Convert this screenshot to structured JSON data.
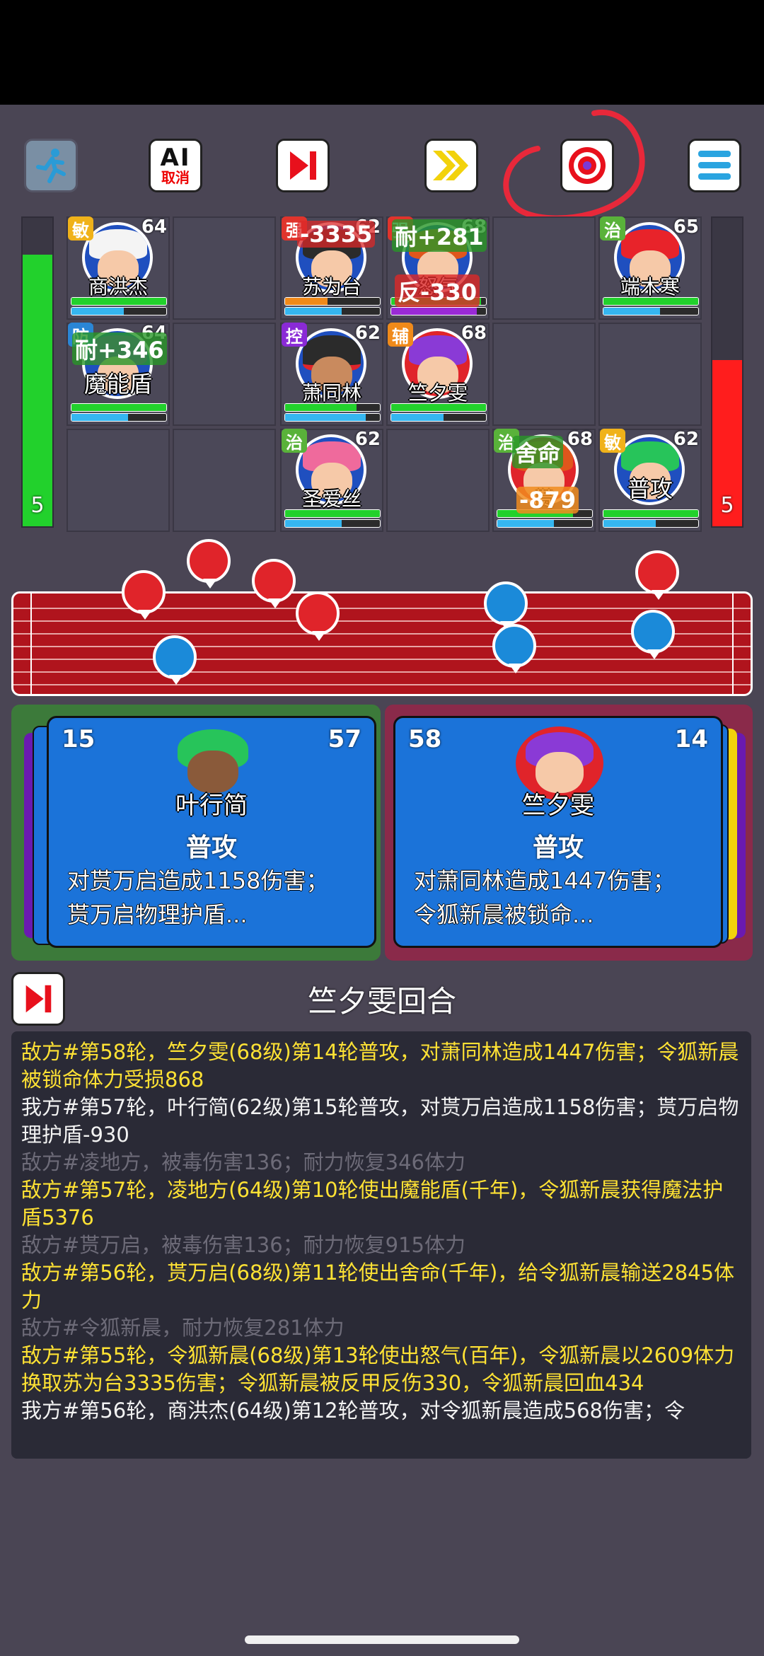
{
  "toolbar": {
    "ai_label": "AI",
    "ai_sub_label": "取消"
  },
  "team_hp": {
    "left_count": "5",
    "right_count": "5",
    "left_fill_fraction": 0.88,
    "right_fill_fraction": 0.54
  },
  "units": [
    {
      "tag": "敏",
      "level": "64",
      "name": "商洪杰",
      "hp": 1.0,
      "mp": 0.55
    },
    {
      "tag": "强",
      "level": "62",
      "name": "苏为台",
      "hp": 0.45,
      "mp": 0.6
    },
    {
      "tag": "强",
      "level": "68",
      "name": "怒气",
      "hp": 0.95,
      "mp": 0.9
    },
    {
      "tag": "治",
      "level": "65",
      "name": "端木寒",
      "hp": 1.0,
      "mp": 0.6
    },
    {
      "tag": "防",
      "level": "64",
      "name": "魔能盾",
      "hp": 1.0,
      "mp": 0.6
    },
    {
      "tag": "控",
      "level": "62",
      "name": "萧同林",
      "hp": 0.75,
      "mp": 0.85
    },
    {
      "tag": "辅",
      "level": "68",
      "name": "竺夕雯",
      "hp": 1.0,
      "mp": 0.55
    },
    {
      "tag": "治",
      "level": "62",
      "name": "圣爱丝",
      "hp": 1.0,
      "mp": 0.6
    },
    {
      "tag": "治",
      "level": "68",
      "name": "贳",
      "hp": 0.8,
      "mp": 0.6
    },
    {
      "tag": "敏",
      "level": "62",
      "name": "普攻",
      "hp": 1.0,
      "mp": 0.55
    }
  ],
  "floaters": {
    "damage_1": "-3335",
    "heal_1": "耐+281",
    "reflect_1": "反-330",
    "heal_2": "耐+346",
    "skill_1": "舍命",
    "damage_2": "-879"
  },
  "card_left": {
    "num_left": "15",
    "num_right": "57",
    "name": "叶行简",
    "skill": "普攻",
    "desc_line1": "对贳万启造成1158伤害；",
    "desc_line2": "贳万启物理护盾..."
  },
  "card_right": {
    "num_left": "58",
    "num_right": "14",
    "name": "竺夕雯",
    "skill": "普攻",
    "desc_line1": "对萧同林造成1447伤害；",
    "desc_line2": "令狐新晨被锁命..."
  },
  "turn_title": "竺夕雯回合",
  "log": [
    {
      "color": "yellow",
      "text": "敌方#第58轮，竺夕雯(68级)第14轮普攻，对萧同林造成1447伤害；令狐新晨被锁命体力受损868"
    },
    {
      "color": "white",
      "text": "我方#第57轮，叶行简(62级)第15轮普攻，对贳万启造成1158伤害；贳万启物理护盾-930"
    },
    {
      "color": "gray",
      "text": "敌方#凌地方，被毒伤害136；耐力恢复346体力"
    },
    {
      "color": "yellow",
      "text": "敌方#第57轮，凌地方(64级)第10轮使出魔能盾(千年)，令狐新晨获得魔法护盾5376"
    },
    {
      "color": "gray",
      "text": "敌方#贳万启，被毒伤害136；耐力恢复915体力"
    },
    {
      "color": "yellow",
      "text": "敌方#第56轮，贳万启(68级)第11轮使出舍命(千年)，给令狐新晨输送2845体力"
    },
    {
      "color": "gray",
      "text": "敌方#令狐新晨，耐力恢复281体力"
    },
    {
      "color": "yellow",
      "text": "敌方#第55轮，令狐新晨(68级)第13轮使出怒气(百年)，令狐新晨以2609体力换取苏为台3335伤害；令狐新晨被反甲反伤330，令狐新晨回血434"
    },
    {
      "color": "white",
      "text": "我方#第56轮，商洪杰(64级)第12轮普攻，对令狐新晨造成568伤害；令"
    }
  ],
  "colors": {
    "background": "#4a4554",
    "ally_hp": "#22d12c",
    "enemy_hp": "#ff1d1d",
    "card_blue": "#1b73d9",
    "log_yellow": "#ffe234"
  }
}
